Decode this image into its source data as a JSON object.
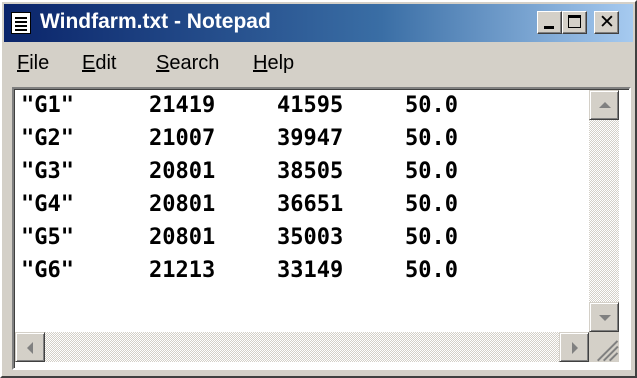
{
  "window": {
    "title": "Windfarm.txt - Notepad",
    "icon": "notepad-icon",
    "controls": {
      "minimize": "minimize-icon",
      "maximize": "maximize-icon",
      "close": "close-icon",
      "close_glyph": "✕"
    }
  },
  "menubar": {
    "items": [
      {
        "mnemonic": "F",
        "rest": "ile"
      },
      {
        "mnemonic": "E",
        "rest": "dit"
      },
      {
        "mnemonic": "S",
        "rest": "earch"
      },
      {
        "mnemonic": "H",
        "rest": "elp"
      }
    ]
  },
  "document": {
    "rows": [
      {
        "id": "\"G1\"",
        "x": "21419",
        "y": "41595",
        "value": "50.0"
      },
      {
        "id": "\"G2\"",
        "x": "21007",
        "y": "39947",
        "value": "50.0"
      },
      {
        "id": "\"G3\"",
        "x": "20801",
        "y": "38505",
        "value": "50.0"
      },
      {
        "id": "\"G4\"",
        "x": "20801",
        "y": "36651",
        "value": "50.0"
      },
      {
        "id": "\"G5\"",
        "x": "20801",
        "y": "35003",
        "value": "50.0"
      },
      {
        "id": "\"G6\"",
        "x": "21213",
        "y": "33149",
        "value": "50.0"
      }
    ]
  },
  "colors": {
    "titlebar_start": "#0a246a",
    "titlebar_end": "#a6caf0",
    "face": "#d4d0c8"
  }
}
